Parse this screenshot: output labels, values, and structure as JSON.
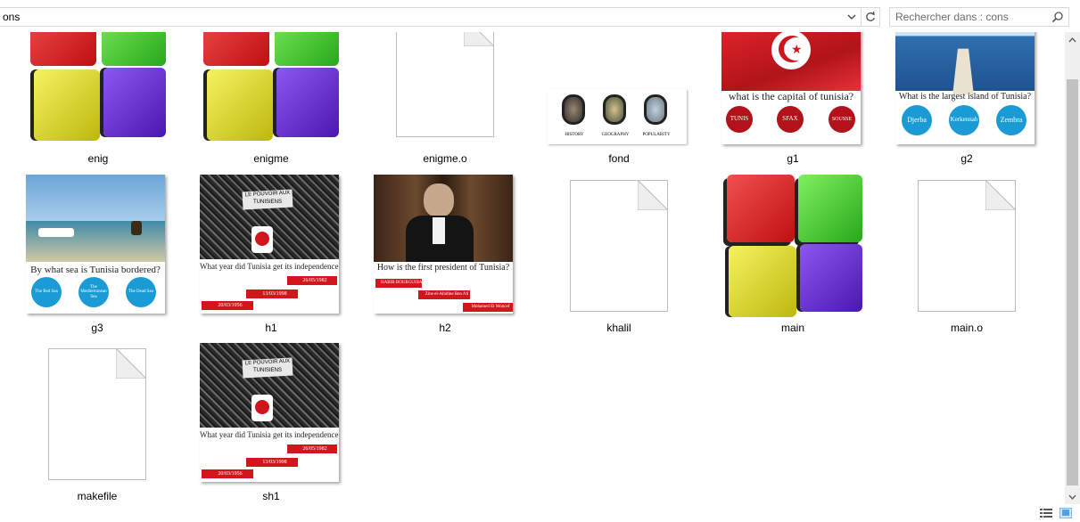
{
  "address": {
    "path": "ons"
  },
  "search": {
    "placeholder": "Rechercher dans : cons"
  },
  "files": [
    {
      "name": "enig",
      "kind": "cube"
    },
    {
      "name": "enigme",
      "kind": "cube"
    },
    {
      "name": "enigme.o",
      "kind": "file"
    },
    {
      "name": "fond",
      "kind": "image"
    },
    {
      "name": "g1",
      "kind": "image"
    },
    {
      "name": "g2",
      "kind": "image"
    },
    {
      "name": "g3",
      "kind": "image"
    },
    {
      "name": "h1",
      "kind": "image"
    },
    {
      "name": "h2",
      "kind": "image"
    },
    {
      "name": "khalil",
      "kind": "file"
    },
    {
      "name": "main",
      "kind": "cube"
    },
    {
      "name": "main.o",
      "kind": "file"
    },
    {
      "name": "makefile",
      "kind": "file"
    },
    {
      "name": "sh1",
      "kind": "image"
    }
  ],
  "thumbs": {
    "fond": {
      "labels": [
        "HISTORY",
        "GEOGRAPHY",
        "POPULARITY"
      ]
    },
    "g1": {
      "question": "what is the capital of tunisia?",
      "answers": [
        "TUNIS",
        "SFAX",
        "SOUSSE"
      ]
    },
    "g2": {
      "question": "What is the largest island of Tunisia?",
      "answers": [
        "Djerba",
        "Kerkennah",
        "Zembra"
      ]
    },
    "g3": {
      "question": "By what sea is Tunisia bordered?",
      "answers": [
        "The Red Sea",
        "The Mediterranean Sea",
        "The Dead Sea"
      ]
    },
    "h1": {
      "banner1": "LE POUVOIR AUX",
      "banner2": "TUNISIENS",
      "question": "What year did Tunisia get its independence?",
      "answers": [
        "26/05/1982",
        "13/03/1998",
        "20/03/1956"
      ]
    },
    "h2": {
      "question": "How is the first president of Tunisia?",
      "answers": [
        "HABIB BOURGUIBA",
        "Zine el-Abidine Ben Ali",
        "Mohamed El Moncef"
      ]
    },
    "sh1": {
      "banner1": "LE POUVOIR AUX",
      "banner2": "TUNISIENS",
      "question": "What year did Tunisia get its independence?",
      "answers": [
        "26/05/1982",
        "13/03/1998",
        "20/03/1956"
      ]
    }
  },
  "colors": {
    "cube_red": "#d81e1e",
    "cube_green": "#3ecb2c",
    "cube_yellow": "#e0dc1e",
    "cube_purple": "#6a2fd8",
    "answer_red": "#b3121a",
    "answer_blue": "#1b9bd6"
  }
}
